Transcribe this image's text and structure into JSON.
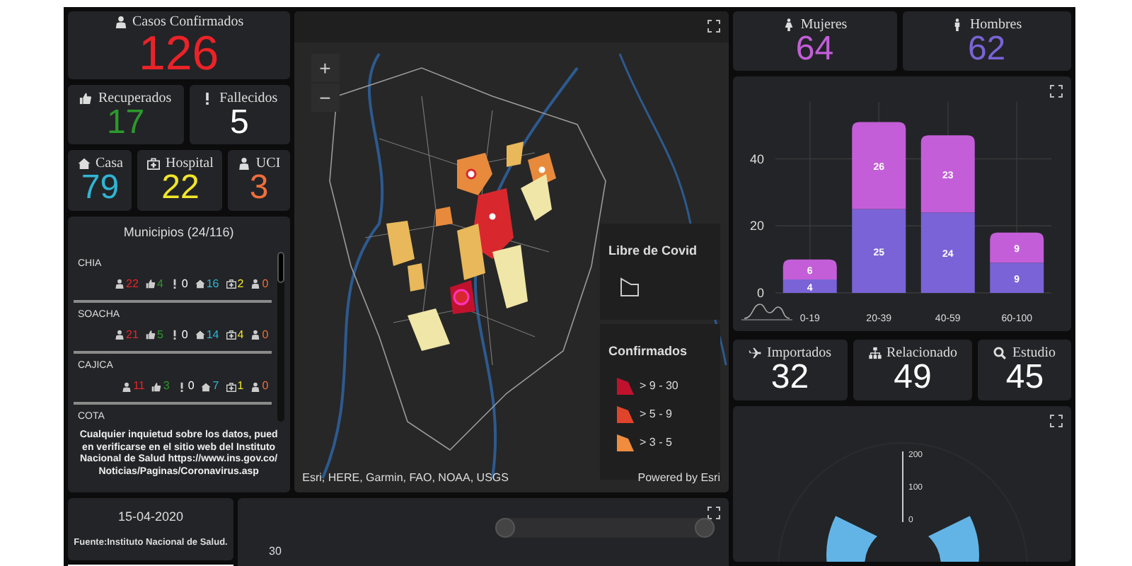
{
  "confirmed": {
    "kind": "confirmed",
    "label": "Casos Confirmados",
    "value": "126"
  },
  "outcomes": [
    {
      "kind": "recovered",
      "label": "Recuperados",
      "value": "17"
    },
    {
      "kind": "deceased",
      "label": "Fallecidos",
      "value": "5"
    }
  ],
  "care": [
    {
      "kind": "home",
      "label": "Casa",
      "value": "79"
    },
    {
      "kind": "hospital",
      "label": "Hospital",
      "value": "22"
    },
    {
      "kind": "icu",
      "label": "UCI",
      "value": "3"
    }
  ],
  "municipalities": {
    "title": "Municipios (24/116)",
    "items": [
      {
        "name": "CHIA",
        "stats": [
          {
            "kind": "confirmed",
            "value": "22"
          },
          {
            "kind": "recovered",
            "value": "4"
          },
          {
            "kind": "deceased",
            "value": "0"
          },
          {
            "kind": "home",
            "value": "16"
          },
          {
            "kind": "hospital",
            "value": "2"
          },
          {
            "kind": "icu",
            "value": "0"
          }
        ]
      },
      {
        "name": "SOACHA",
        "stats": [
          {
            "kind": "confirmed",
            "value": "21"
          },
          {
            "kind": "recovered",
            "value": "5"
          },
          {
            "kind": "deceased",
            "value": "0"
          },
          {
            "kind": "home",
            "value": "14"
          },
          {
            "kind": "hospital",
            "value": "4"
          },
          {
            "kind": "icu",
            "value": "0"
          }
        ]
      },
      {
        "name": "CAJICA",
        "stats": [
          {
            "kind": "confirmed",
            "value": "11"
          },
          {
            "kind": "recovered",
            "value": "3"
          },
          {
            "kind": "deceased",
            "value": "0"
          },
          {
            "kind": "home",
            "value": "7"
          },
          {
            "kind": "hospital",
            "value": "1"
          },
          {
            "kind": "icu",
            "value": "0"
          }
        ]
      },
      {
        "name": "COTA"
      }
    ],
    "note": "Cualquier inquietud sobre los datos, pueden verificarse en el sitio web del Instituto Nacional de Salud https://www.ins.gov.co/Noticias/Paginas/Coronavirus.asp"
  },
  "source_card": {
    "date": "15-04-2020",
    "source": "Fuente:Instituto Nacional de Salud."
  },
  "map": {
    "zoom_controls": [
      "+",
      "−"
    ],
    "legend": {
      "free_title": "Libre de Covid",
      "confirmed_title": "Confirmados",
      "classes": [
        {
          "label": "> 9 - 30",
          "color": "#c0122c"
        },
        {
          "label": "> 5 - 9",
          "color": "#e0452b"
        },
        {
          "label": "> 3 - 5",
          "color": "#ef8c3e"
        }
      ]
    },
    "attribution": "Esri, HERE, Garmin, FAO, NOAA, USGS",
    "powered_by": "Powered by Esri"
  },
  "timeline": {
    "ytick": "30"
  },
  "sex": [
    {
      "kind": "female",
      "label": "Mujeres",
      "value": "64"
    },
    {
      "kind": "male",
      "label": "Hombres",
      "value": "62"
    }
  ],
  "age_chart": {
    "chart_data": {
      "type": "bar",
      "categories": [
        "0-19",
        "20-39",
        "40-59",
        "60-100"
      ],
      "stacked": true,
      "grid": true,
      "data_labels": true,
      "ylim": [
        0,
        57
      ],
      "yticks": [
        0,
        20,
        40
      ],
      "series": [
        {
          "color": "#7a63d6",
          "values": [
            4,
            25,
            24,
            9
          ]
        },
        {
          "color": "#c35ed8",
          "values": [
            6,
            26,
            23,
            9
          ]
        }
      ]
    }
  },
  "origin": [
    {
      "kind": "imported",
      "label": "Importados",
      "value": "32"
    },
    {
      "kind": "related",
      "label": "Relacionado",
      "value": "49"
    },
    {
      "kind": "study",
      "label": "Estudio",
      "value": "45"
    }
  ],
  "gauge": {
    "ticks": [
      "200",
      "100",
      "0"
    ]
  }
}
